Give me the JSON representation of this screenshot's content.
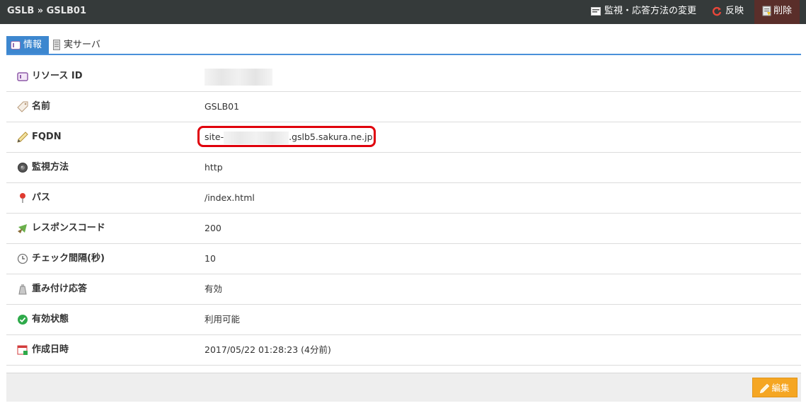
{
  "breadcrumb": "GSLB » GSLB01",
  "header": {
    "monitor_label": "監視・応答方法の変更",
    "reflect_label": "反映",
    "delete_label": "削除"
  },
  "tabs": [
    {
      "label": "情報",
      "active": true
    },
    {
      "label": "実サーバ",
      "active": false
    }
  ],
  "details": [
    {
      "label": "リソース ID",
      "icon": "id-card-icon",
      "value": ""
    },
    {
      "label": "名前",
      "icon": "tag-icon",
      "value": "GSLB01"
    },
    {
      "label": "FQDN",
      "icon": "pencil-icon",
      "value_prefix": "site-",
      "value_suffix": ".gslb5.sakura.ne.jp"
    },
    {
      "label": "監視方法",
      "icon": "lens-icon",
      "value": "http"
    },
    {
      "label": "パス",
      "icon": "pin-icon",
      "value": "/index.html"
    },
    {
      "label": "レスポンスコード",
      "icon": "response-icon",
      "value": "200"
    },
    {
      "label": "チェック間隔(秒)",
      "icon": "clock-icon",
      "value": "10"
    },
    {
      "label": "重み付け応答",
      "icon": "weight-icon",
      "value": "有効"
    },
    {
      "label": "有効状態",
      "icon": "check-icon",
      "value": "利用可能"
    },
    {
      "label": "作成日時",
      "icon": "calendar-icon",
      "value": "2017/05/22 01:28:23 (4分前)"
    }
  ],
  "footer": {
    "edit_label": "編集"
  },
  "colors": {
    "header_bg": "#353a3a",
    "accent": "#3d87cf",
    "highlight": "#e0000b",
    "edit_button": "#f5a623",
    "delete_bg": "#5a2e2a"
  }
}
